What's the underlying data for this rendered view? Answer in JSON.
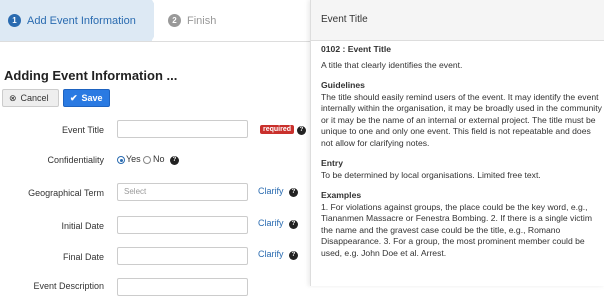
{
  "wizard": {
    "steps": [
      {
        "num": "1",
        "label": "Add Event Information"
      },
      {
        "num": "2",
        "label": "Finish"
      }
    ]
  },
  "form": {
    "heading": "Adding Event Information ...",
    "cancel_label": "Cancel",
    "save_label": "Save",
    "event_title_label": "Event Title",
    "required_badge": "required",
    "confidentiality_label": "Confidentiality",
    "yes_label": "Yes",
    "no_label": "No",
    "geo_label": "Geographical Term",
    "geo_placeholder": "Select",
    "clarify_label": "Clarify",
    "initial_date_label": "Initial Date",
    "final_date_label": "Final Date",
    "event_description_label": "Event Description"
  },
  "panel": {
    "title": "Event Title",
    "field_code": "0102 : Event Title",
    "summary": "A title that clearly identifies the event.",
    "guidelines_heading": "Guidelines",
    "guidelines_text": "The title should easily remind users of the event. It may identify the event internally within the organisation, it may be broadly used in the community or it may be the name of an internal or external project. The title must be unique to one and only one event. This field is not repeatable and does not allow for clarifying notes.",
    "entry_heading": "Entry",
    "entry_text": "To be determined by local organisations. Limited free text.",
    "examples_heading": "Examples",
    "examples_text": "1. For violations against groups, the place could be the key word, e.g., Tiananmen Massacre or Fenestra Bombing. 2. If there is a single victim the name and the gravest case could be the title, e.g., Romano Disappearance. 3. For a group, the most prominent member could be used, e.g. John Doe et al. Arrest."
  },
  "colors": {
    "accent": "#2a6bb0",
    "save": "#2a7ae2",
    "required": "#c9302c"
  }
}
